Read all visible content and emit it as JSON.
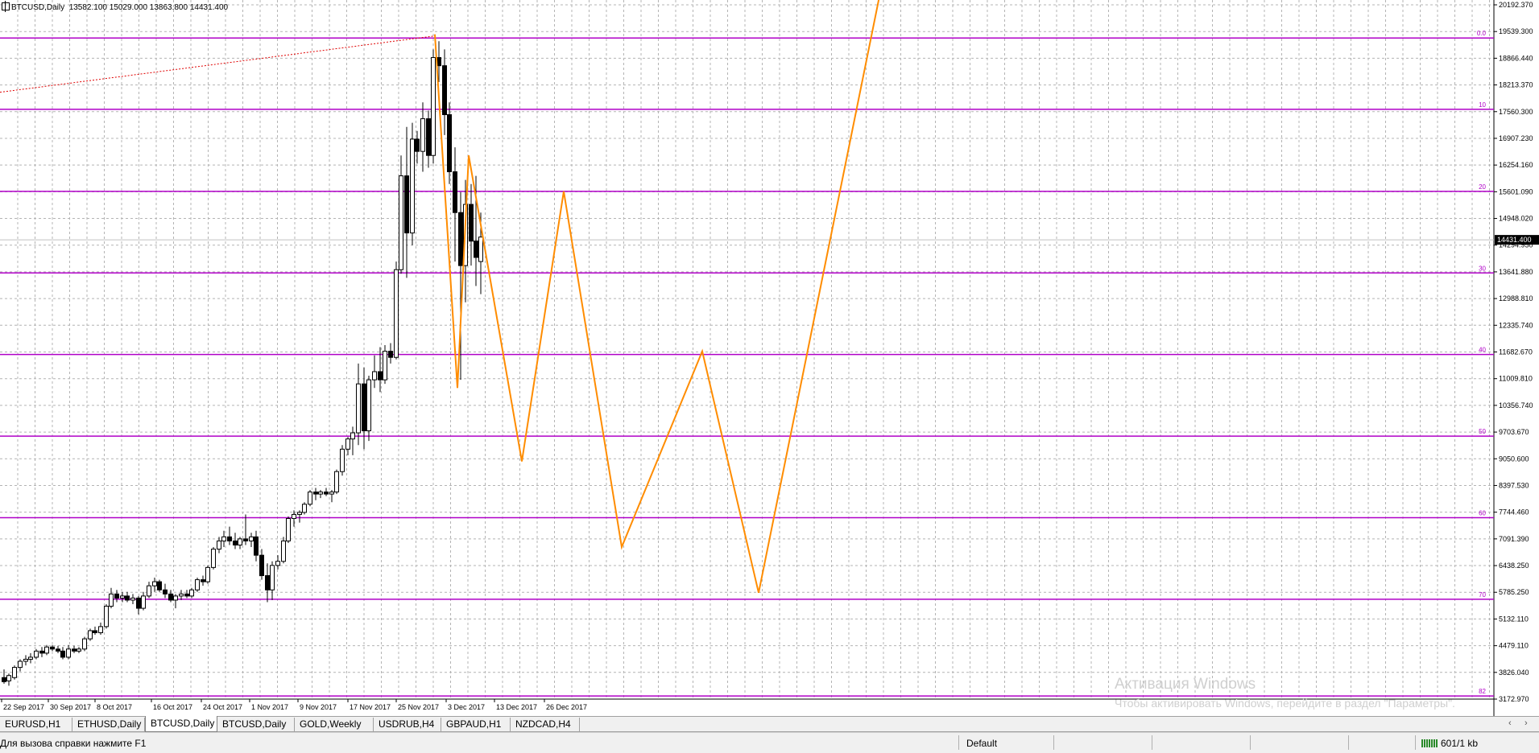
{
  "chart": {
    "symbol": "BTCUSD,Daily",
    "ohlc_text": "13582.100 15029.000 13863.800 14431.400",
    "current_price": "14431.400"
  },
  "chart_data": {
    "type": "candlestick",
    "price_axis": [
      "20192.370",
      "19539.300",
      "18866.440",
      "18213.370",
      "17560.300",
      "16907.230",
      "16254.160",
      "15601.090",
      "14948.020",
      "14294.950",
      "13641.880",
      "12988.810",
      "12335.740",
      "11682.670",
      "11009.810",
      "10356.740",
      "9703.670",
      "9050.600",
      "8397.530",
      "7744.460",
      "7091.390",
      "6438.250",
      "5785.250",
      "5132.110",
      "4479.110",
      "3826.040",
      "3172.970"
    ],
    "y_range": [
      3172.97,
      20192.37
    ],
    "date_axis": [
      "22 Sep 2017",
      "30 Sep 2017",
      "8 Oct 2017",
      "16 Oct 2017",
      "24 Oct 2017",
      "1 Nov 2017",
      "9 Nov 2017",
      "17 Nov 2017",
      "25 Nov 2017",
      "3 Dec 2017",
      "13 Dec 2017",
      "26 Dec 2017"
    ],
    "current_price": 14431.4,
    "fib_levels": [
      {
        "label": "0.0",
        "price": 19380
      },
      {
        "label": "10",
        "price": 17630
      },
      {
        "label": "20",
        "price": 15620
      },
      {
        "label": "30",
        "price": 13620
      },
      {
        "label": "40",
        "price": 11620
      },
      {
        "label": "50",
        "price": 9620
      },
      {
        "label": "60",
        "price": 7620
      },
      {
        "label": "70",
        "price": 5620
      },
      {
        "label": "82",
        "price": 3250
      }
    ],
    "trendline": {
      "start": [
        0,
        18050
      ],
      "end": [
        540,
        19430
      ]
    },
    "forecast_zigzag": [
      [
        540,
        19470
      ],
      [
        568,
        10800
      ],
      [
        582,
        16500
      ],
      [
        648,
        9000
      ],
      [
        700,
        15620
      ],
      [
        772,
        6900
      ],
      [
        872,
        11700
      ],
      [
        942,
        5780
      ],
      [
        1092,
        20400
      ]
    ],
    "candles": [
      {
        "x": 5,
        "o": 3700,
        "h": 3900,
        "l": 3550,
        "c": 3600
      },
      {
        "x": 11,
        "o": 3620,
        "h": 3800,
        "l": 3500,
        "c": 3750
      },
      {
        "x": 18,
        "o": 3700,
        "h": 4000,
        "l": 3650,
        "c": 3950
      },
      {
        "x": 25,
        "o": 3950,
        "h": 4150,
        "l": 3850,
        "c": 4100
      },
      {
        "x": 32,
        "o": 4100,
        "h": 4250,
        "l": 4000,
        "c": 4150
      },
      {
        "x": 38,
        "o": 4150,
        "h": 4300,
        "l": 4050,
        "c": 4200
      },
      {
        "x": 45,
        "o": 4200,
        "h": 4400,
        "l": 4150,
        "c": 4350
      },
      {
        "x": 52,
        "o": 4350,
        "h": 4450,
        "l": 4200,
        "c": 4300
      },
      {
        "x": 58,
        "o": 4300,
        "h": 4500,
        "l": 4250,
        "c": 4450
      },
      {
        "x": 65,
        "o": 4450,
        "h": 4500,
        "l": 4350,
        "c": 4400
      },
      {
        "x": 72,
        "o": 4400,
        "h": 4480,
        "l": 4300,
        "c": 4350
      },
      {
        "x": 78,
        "o": 4350,
        "h": 4450,
        "l": 4150,
        "c": 4200
      },
      {
        "x": 85,
        "o": 4200,
        "h": 4500,
        "l": 4150,
        "c": 4400
      },
      {
        "x": 92,
        "o": 4400,
        "h": 4480,
        "l": 4300,
        "c": 4350
      },
      {
        "x": 98,
        "o": 4350,
        "h": 4450,
        "l": 4300,
        "c": 4400
      },
      {
        "x": 105,
        "o": 4400,
        "h": 4700,
        "l": 4350,
        "c": 4650
      },
      {
        "x": 112,
        "o": 4650,
        "h": 4900,
        "l": 4600,
        "c": 4850
      },
      {
        "x": 118,
        "o": 4850,
        "h": 4950,
        "l": 4750,
        "c": 4800
      },
      {
        "x": 125,
        "o": 4800,
        "h": 5050,
        "l": 4750,
        "c": 4950
      },
      {
        "x": 132,
        "o": 4950,
        "h": 5500,
        "l": 4900,
        "c": 5450
      },
      {
        "x": 138,
        "o": 5450,
        "h": 5900,
        "l": 5400,
        "c": 5750
      },
      {
        "x": 145,
        "o": 5750,
        "h": 5850,
        "l": 5550,
        "c": 5650
      },
      {
        "x": 152,
        "o": 5650,
        "h": 5800,
        "l": 5550,
        "c": 5700
      },
      {
        "x": 158,
        "o": 5700,
        "h": 5800,
        "l": 5550,
        "c": 5600
      },
      {
        "x": 165,
        "o": 5600,
        "h": 5750,
        "l": 5500,
        "c": 5650
      },
      {
        "x": 172,
        "o": 5650,
        "h": 5700,
        "l": 5250,
        "c": 5400
      },
      {
        "x": 178,
        "o": 5400,
        "h": 5800,
        "l": 5350,
        "c": 5700
      },
      {
        "x": 185,
        "o": 5700,
        "h": 6050,
        "l": 5650,
        "c": 5950
      },
      {
        "x": 192,
        "o": 5950,
        "h": 6150,
        "l": 5800,
        "c": 6050
      },
      {
        "x": 198,
        "o": 6050,
        "h": 6100,
        "l": 5800,
        "c": 5850
      },
      {
        "x": 205,
        "o": 5850,
        "h": 6000,
        "l": 5650,
        "c": 5750
      },
      {
        "x": 212,
        "o": 5750,
        "h": 5850,
        "l": 5550,
        "c": 5600
      },
      {
        "x": 218,
        "o": 5600,
        "h": 5750,
        "l": 5400,
        "c": 5700
      },
      {
        "x": 225,
        "o": 5700,
        "h": 5850,
        "l": 5600,
        "c": 5750
      },
      {
        "x": 232,
        "o": 5750,
        "h": 5850,
        "l": 5650,
        "c": 5700
      },
      {
        "x": 238,
        "o": 5700,
        "h": 5900,
        "l": 5650,
        "c": 5850
      },
      {
        "x": 245,
        "o": 5850,
        "h": 6150,
        "l": 5800,
        "c": 6100
      },
      {
        "x": 252,
        "o": 6100,
        "h": 6200,
        "l": 5950,
        "c": 6050
      },
      {
        "x": 258,
        "o": 6050,
        "h": 6450,
        "l": 6000,
        "c": 6400
      },
      {
        "x": 265,
        "o": 6400,
        "h": 6900,
        "l": 6350,
        "c": 6850
      },
      {
        "x": 272,
        "o": 6850,
        "h": 7150,
        "l": 6750,
        "c": 7050
      },
      {
        "x": 278,
        "o": 7050,
        "h": 7300,
        "l": 6900,
        "c": 7150
      },
      {
        "x": 285,
        "o": 7150,
        "h": 7400,
        "l": 6950,
        "c": 7050
      },
      {
        "x": 292,
        "o": 7050,
        "h": 7250,
        "l": 6850,
        "c": 6950
      },
      {
        "x": 298,
        "o": 6950,
        "h": 7150,
        "l": 6850,
        "c": 7100
      },
      {
        "x": 305,
        "o": 7100,
        "h": 7700,
        "l": 6950,
        "c": 7050
      },
      {
        "x": 312,
        "o": 7050,
        "h": 7250,
        "l": 6900,
        "c": 7150
      },
      {
        "x": 318,
        "o": 7150,
        "h": 7300,
        "l": 6550,
        "c": 6700
      },
      {
        "x": 325,
        "o": 6700,
        "h": 6850,
        "l": 6100,
        "c": 6200
      },
      {
        "x": 332,
        "o": 6200,
        "h": 6500,
        "l": 5550,
        "c": 5850
      },
      {
        "x": 338,
        "o": 5850,
        "h": 6550,
        "l": 5600,
        "c": 6450
      },
      {
        "x": 345,
        "o": 6450,
        "h": 6700,
        "l": 6350,
        "c": 6550
      },
      {
        "x": 352,
        "o": 6550,
        "h": 7150,
        "l": 6500,
        "c": 7050
      },
      {
        "x": 358,
        "o": 7050,
        "h": 7650,
        "l": 7000,
        "c": 7600
      },
      {
        "x": 365,
        "o": 7600,
        "h": 7800,
        "l": 7400,
        "c": 7700
      },
      {
        "x": 372,
        "o": 7700,
        "h": 7800,
        "l": 7500,
        "c": 7750
      },
      {
        "x": 378,
        "o": 7750,
        "h": 8000,
        "l": 7700,
        "c": 7950
      },
      {
        "x": 385,
        "o": 7950,
        "h": 8300,
        "l": 7900,
        "c": 8250
      },
      {
        "x": 392,
        "o": 8250,
        "h": 8350,
        "l": 8050,
        "c": 8200
      },
      {
        "x": 398,
        "o": 8200,
        "h": 8300,
        "l": 8100,
        "c": 8250
      },
      {
        "x": 405,
        "o": 8250,
        "h": 8350,
        "l": 8150,
        "c": 8200
      },
      {
        "x": 412,
        "o": 8200,
        "h": 8300,
        "l": 8000,
        "c": 8250
      },
      {
        "x": 418,
        "o": 8250,
        "h": 8800,
        "l": 8200,
        "c": 8750
      },
      {
        "x": 425,
        "o": 8750,
        "h": 9400,
        "l": 8650,
        "c": 9300
      },
      {
        "x": 432,
        "o": 9300,
        "h": 9600,
        "l": 9150,
        "c": 9550
      },
      {
        "x": 438,
        "o": 9550,
        "h": 9850,
        "l": 9150,
        "c": 9700
      },
      {
        "x": 445,
        "o": 9700,
        "h": 11400,
        "l": 9400,
        "c": 10900
      },
      {
        "x": 452,
        "o": 10900,
        "h": 11300,
        "l": 9300,
        "c": 9750
      },
      {
        "x": 458,
        "o": 9750,
        "h": 11100,
        "l": 9500,
        "c": 11000
      },
      {
        "x": 465,
        "o": 11000,
        "h": 11600,
        "l": 10800,
        "c": 11200
      },
      {
        "x": 472,
        "o": 11200,
        "h": 11800,
        "l": 10700,
        "c": 11000
      },
      {
        "x": 478,
        "o": 11000,
        "h": 11850,
        "l": 10900,
        "c": 11700
      },
      {
        "x": 485,
        "o": 11700,
        "h": 11900,
        "l": 11400,
        "c": 11550
      },
      {
        "x": 492,
        "o": 11550,
        "h": 13900,
        "l": 11500,
        "c": 13700
      },
      {
        "x": 498,
        "o": 13700,
        "h": 16500,
        "l": 13600,
        "c": 16000
      },
      {
        "x": 505,
        "o": 16000,
        "h": 17200,
        "l": 13500,
        "c": 14600
      },
      {
        "x": 512,
        "o": 14600,
        "h": 17300,
        "l": 14300,
        "c": 16900
      },
      {
        "x": 518,
        "o": 16900,
        "h": 17100,
        "l": 16300,
        "c": 16600
      },
      {
        "x": 525,
        "o": 16600,
        "h": 17800,
        "l": 16100,
        "c": 17400
      },
      {
        "x": 532,
        "o": 17400,
        "h": 17600,
        "l": 16200,
        "c": 16500
      },
      {
        "x": 538,
        "o": 16500,
        "h": 19100,
        "l": 16300,
        "c": 18900
      },
      {
        "x": 545,
        "o": 18900,
        "h": 19300,
        "l": 18300,
        "c": 18700
      },
      {
        "x": 552,
        "o": 18700,
        "h": 19100,
        "l": 17000,
        "c": 17500
      },
      {
        "x": 558,
        "o": 17500,
        "h": 17800,
        "l": 15800,
        "c": 16100
      },
      {
        "x": 565,
        "o": 16100,
        "h": 16700,
        "l": 13900,
        "c": 15100
      },
      {
        "x": 572,
        "o": 15100,
        "h": 15600,
        "l": 11000,
        "c": 13800
      },
      {
        "x": 578,
        "o": 13800,
        "h": 15900,
        "l": 12900,
        "c": 15300
      },
      {
        "x": 585,
        "o": 15300,
        "h": 15800,
        "l": 13800,
        "c": 14400
      },
      {
        "x": 591,
        "o": 14400,
        "h": 16000,
        "l": 13300,
        "c": 14000
      },
      {
        "x": 597,
        "o": 13900,
        "h": 15100,
        "l": 13100,
        "c": 14500
      }
    ]
  },
  "watermark": {
    "title": "Активация Windows",
    "subtitle": "Чтобы активировать Windows, перейдите в раздел \"Параметры\"."
  },
  "tabs": [
    {
      "label": "EURUSD,H1",
      "active": false
    },
    {
      "label": "ETHUSD,Daily",
      "active": false
    },
    {
      "label": "BTCUSD,Daily",
      "active": true
    },
    {
      "label": "BTCUSD,Daily",
      "active": false
    },
    {
      "label": "GOLD,Weekly",
      "active": false
    },
    {
      "label": "USDRUB,H4",
      "active": false
    },
    {
      "label": "GBPAUD,H1",
      "active": false
    },
    {
      "label": "NZDCAD,H4",
      "active": false
    }
  ],
  "tab_scroll": {
    "left": "‹",
    "right": "›"
  },
  "status": {
    "help": "Для вызова справки нажмите F1",
    "profile": "Default",
    "connection": "601/1 kb"
  },
  "colors": {
    "grid": "#b4b4b4",
    "fib": "#b000c8",
    "forecast": "#ff8c00",
    "trendline": "#e00000",
    "candle_outline": "#000000",
    "bull_fill": "#ffffff",
    "bear_fill": "#000000",
    "price_tag_bg": "#000000",
    "price_tag_fg": "#ffffff"
  }
}
